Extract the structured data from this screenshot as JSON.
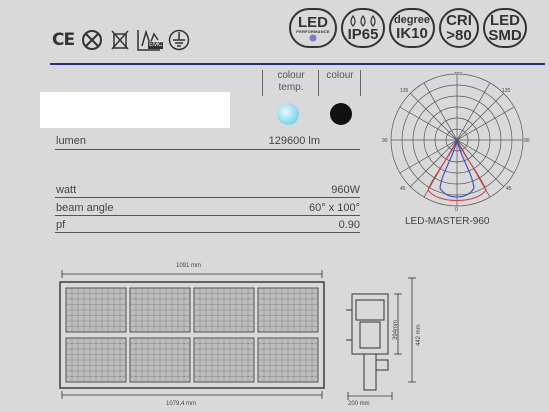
{
  "certifications": {
    "ce_mark": "CE",
    "icons": [
      "ce-mark-icon",
      "x-bin-icon",
      "weee-icon",
      "emc-icon",
      "earth-ground-icon"
    ],
    "emc_text": "EMC"
  },
  "badges": [
    {
      "line1": "LED",
      "line2": "PERFORMANCE",
      "kind": "led-performance"
    },
    {
      "line1": "IP65",
      "kind": "ip65"
    },
    {
      "line1": "degree",
      "line2": "IK10",
      "kind": "ik10"
    },
    {
      "line1": "CRI",
      "line2": ">80",
      "kind": "cri"
    },
    {
      "line1": "LED",
      "line2": "SMD",
      "kind": "led-smd"
    }
  ],
  "color_columns": {
    "colour_temp_label_1": "colour",
    "colour_temp_label_2": "temp.",
    "colour_label": "colour",
    "colour_temp_swatch": "#4fc3e8",
    "colour_swatch": "#111111"
  },
  "specs": {
    "lumen_label": "lumen",
    "lumen_value": "129600 lm",
    "watt_label": "watt",
    "watt_value": "960W",
    "beam_label": "beam angle",
    "beam_value": "60° x 100°",
    "pf_label": "pf",
    "pf_value": "0.90"
  },
  "polar": {
    "model": "LED-MASTER-960",
    "angles": {
      "top": "180",
      "left_top": "135",
      "right_top": "135",
      "left": "90",
      "right": "90",
      "left_bottom": "45",
      "right_bottom": "45",
      "bottom": "0"
    },
    "series_colors": [
      "#d43b3b",
      "#3f48c8"
    ]
  },
  "drawing": {
    "width_top": "1091 mm",
    "width_bottom": "1079,4 mm",
    "side_width": "200 mm",
    "height_inner": "394mm",
    "height_outer": "442 mm"
  }
}
